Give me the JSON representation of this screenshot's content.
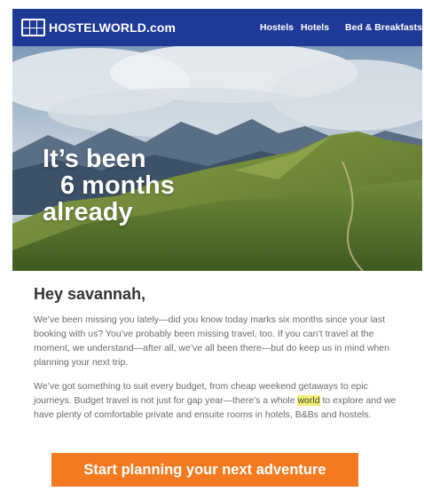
{
  "header": {
    "brand": "HOSTELWORLD.com",
    "nav": [
      "Hostels",
      "Hotels",
      "Bed & Breakfasts"
    ]
  },
  "hero": {
    "line1": "It’s been",
    "line2": "6 months",
    "line3": "already"
  },
  "greeting": "Hey savannah,",
  "paragraph1": "We’ve been missing you lately—did you know today marks six months since your last booking with us? You’ve probably been missing travel, too. If you can’t travel at the moment, we understand—after all, we’ve all been there—but do keep us in mind when planning your next trip.",
  "paragraph2": {
    "before": "We’ve got something to suit every budget, from cheap weekend getaways to epic journeys. Budget travel is not just for gap year—there’s a whole ",
    "highlight": "world",
    "after": " to explore and we have plenty of comfortable private and ensuite rooms in hotels, B&Bs and hostels."
  },
  "cta_label": "Start planning your next adventure",
  "colors": {
    "header_bg": "#1f3a96",
    "cta_bg": "#f47a22",
    "highlight": "#f3f070"
  }
}
